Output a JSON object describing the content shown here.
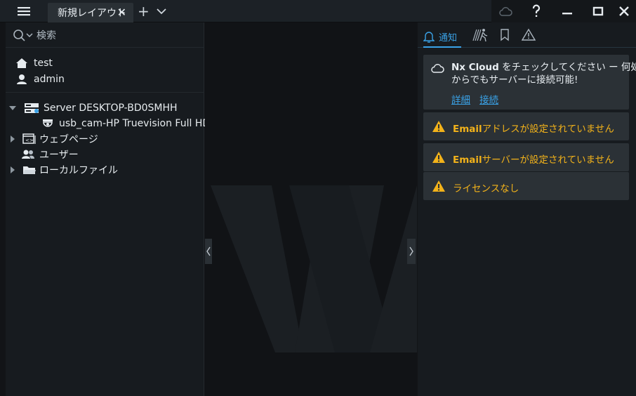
{
  "titlebar": {
    "tab_label": "新規レイアウト",
    "tab_close": "✕",
    "add_tab": "+"
  },
  "search": {
    "placeholder": "検索"
  },
  "tree": {
    "user_items": [
      {
        "label": "test"
      },
      {
        "label": "admin"
      }
    ],
    "server": "Server DESKTOP-BD0SMHH",
    "camera": "usb_cam-HP Truevision Full HD",
    "webpages": "ウェブページ",
    "users": "ユーザー",
    "local_files": "ローカルファイル"
  },
  "right_panel": {
    "notifications_tab": "通知",
    "cloud_card": {
      "line1_bold": "Nx Cloud",
      "line1_rest": " をチェックしてください ー 何処",
      "line2": "からでもサーバーに接続可能!",
      "link_details": "詳細",
      "link_connect": "接続"
    },
    "warnings": [
      {
        "bold": "Email",
        "text": "アドレスが設定されていません"
      },
      {
        "bold": "Email",
        "text": "サーバーが設定されていません"
      },
      {
        "bold": "",
        "text": "ライセンスなし"
      }
    ]
  },
  "colors": {
    "accent": "#3aa2e7",
    "warning": "#f2b21a",
    "panel": "#171b1f",
    "card": "#2b3136"
  },
  "icons": [
    "menu-icon",
    "close-icon",
    "plus-icon",
    "chevron-down-icon",
    "cloud-icon",
    "help-icon",
    "minimize-icon",
    "maximize-icon",
    "search-icon",
    "home-icon",
    "user-icon",
    "server-icon",
    "camera-icon",
    "webpage-icon",
    "users-icon",
    "folder-icon",
    "bell-icon",
    "motion-icon",
    "bookmark-icon",
    "warning-icon"
  ]
}
